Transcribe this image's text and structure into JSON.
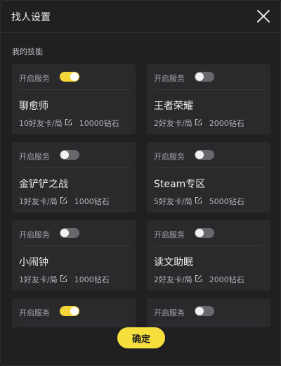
{
  "dialog": {
    "title": "找人设置",
    "section_label": "我的技能",
    "confirm_label": "确定"
  },
  "skills": [
    {
      "service_label": "开启服务",
      "enabled": true,
      "name": "聊愈师",
      "price": "10好友卡/局",
      "diamonds": "10000钻石"
    },
    {
      "service_label": "开启服务",
      "enabled": false,
      "name": "王者荣耀",
      "price": "2好友卡/局",
      "diamonds": "2000钻石"
    },
    {
      "service_label": "开启服务",
      "enabled": false,
      "name": "金铲铲之战",
      "price": "1好友卡/局",
      "diamonds": "1000钻石"
    },
    {
      "service_label": "开启服务",
      "enabled": false,
      "name": "Steam专区",
      "price": "5好友卡/局",
      "diamonds": "5000钻石"
    },
    {
      "service_label": "开启服务",
      "enabled": false,
      "name": "小闹钟",
      "price": "1好友卡/局",
      "diamonds": "1000钻石"
    },
    {
      "service_label": "开启服务",
      "enabled": false,
      "name": "读文助眠",
      "price": "2好友卡/局",
      "diamonds": "2000钻石"
    },
    {
      "service_label": "开启服务",
      "enabled": true,
      "name": "",
      "price": "",
      "diamonds": ""
    },
    {
      "service_label": "开启服务",
      "enabled": false,
      "name": "",
      "price": "",
      "diamonds": ""
    }
  ],
  "colors": {
    "accent": "#f3d738",
    "toggle_off": "#68686c",
    "card_bg": "#2a2a2d"
  }
}
